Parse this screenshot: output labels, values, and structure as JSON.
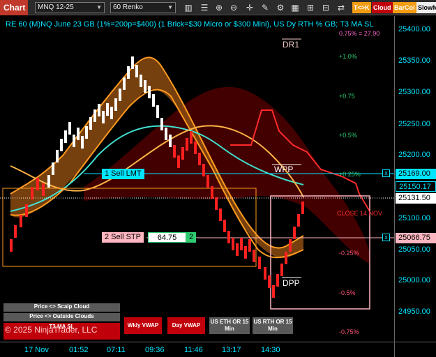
{
  "toolbar": {
    "chart_tab": "Chart",
    "instrument": "MNQ 12-25",
    "period": "60 Renko",
    "buttons": {
      "tk": "T<>K",
      "cloud": "Cloud",
      "barcol": "BarCol",
      "slowm": "SlowM"
    }
  },
  "chart": {
    "title": "RE 60 (M)NQ June 23 GB (1%=200p=$400) (1 Brick=$30 Micro or $300 Mini), US Dy RTH % GB; T3 MA SL",
    "top_right_level": "0.75% = 27.90",
    "levels": {
      "p10": "+1.0%",
      "p075": "+0.75",
      "p05": "+0.5%",
      "p025": "+0.25%",
      "m025": "-0.25%",
      "m05": "-0.5%",
      "m075": "-0.75%"
    },
    "tags": {
      "dr1": "DR1",
      "wpp": "WPP",
      "dpp": "DPP",
      "close": "CLOSE 14 NOV"
    },
    "orders": {
      "sell_lmt": "1 Sell LMT",
      "sell_stp": "2 Sell STP",
      "stp_value": "64.75",
      "stp_qty": "2"
    },
    "close_marks": [
      "x",
      "x"
    ]
  },
  "price_axis": {
    "ticks": [
      "25400.00",
      "25350.00",
      "25300.00",
      "25250.00",
      "25200.00",
      "25100.00",
      "25050.00",
      "25000.00",
      "24950.00"
    ],
    "tags": {
      "limit": "25169.00",
      "t3": "25150.17",
      "last": "25131.50",
      "stop": "25066.75"
    },
    "colors": {
      "limit": "#00e5ff",
      "t3": "#00e5ff",
      "last": "#ffffff",
      "stop": "#ffb6c1"
    }
  },
  "time_axis": {
    "ticks": [
      "17 Nov",
      "01:52",
      "07:11",
      "09:36",
      "11:46",
      "13:17",
      "14:30"
    ]
  },
  "panel": {
    "scalp": "Price <> Scalp Cloud",
    "outside": "Price <> Outside Clouds",
    "t3": "T3 MA SL",
    "wkly_vwap": "Wkly VWAP",
    "day_vwap": "Day VWAP",
    "us_eth": "US ETH OR 15 Min",
    "us_rth": "US RTH OR 15 Min",
    "copyright": "© 2025 NinjaTrader, LLC"
  }
}
